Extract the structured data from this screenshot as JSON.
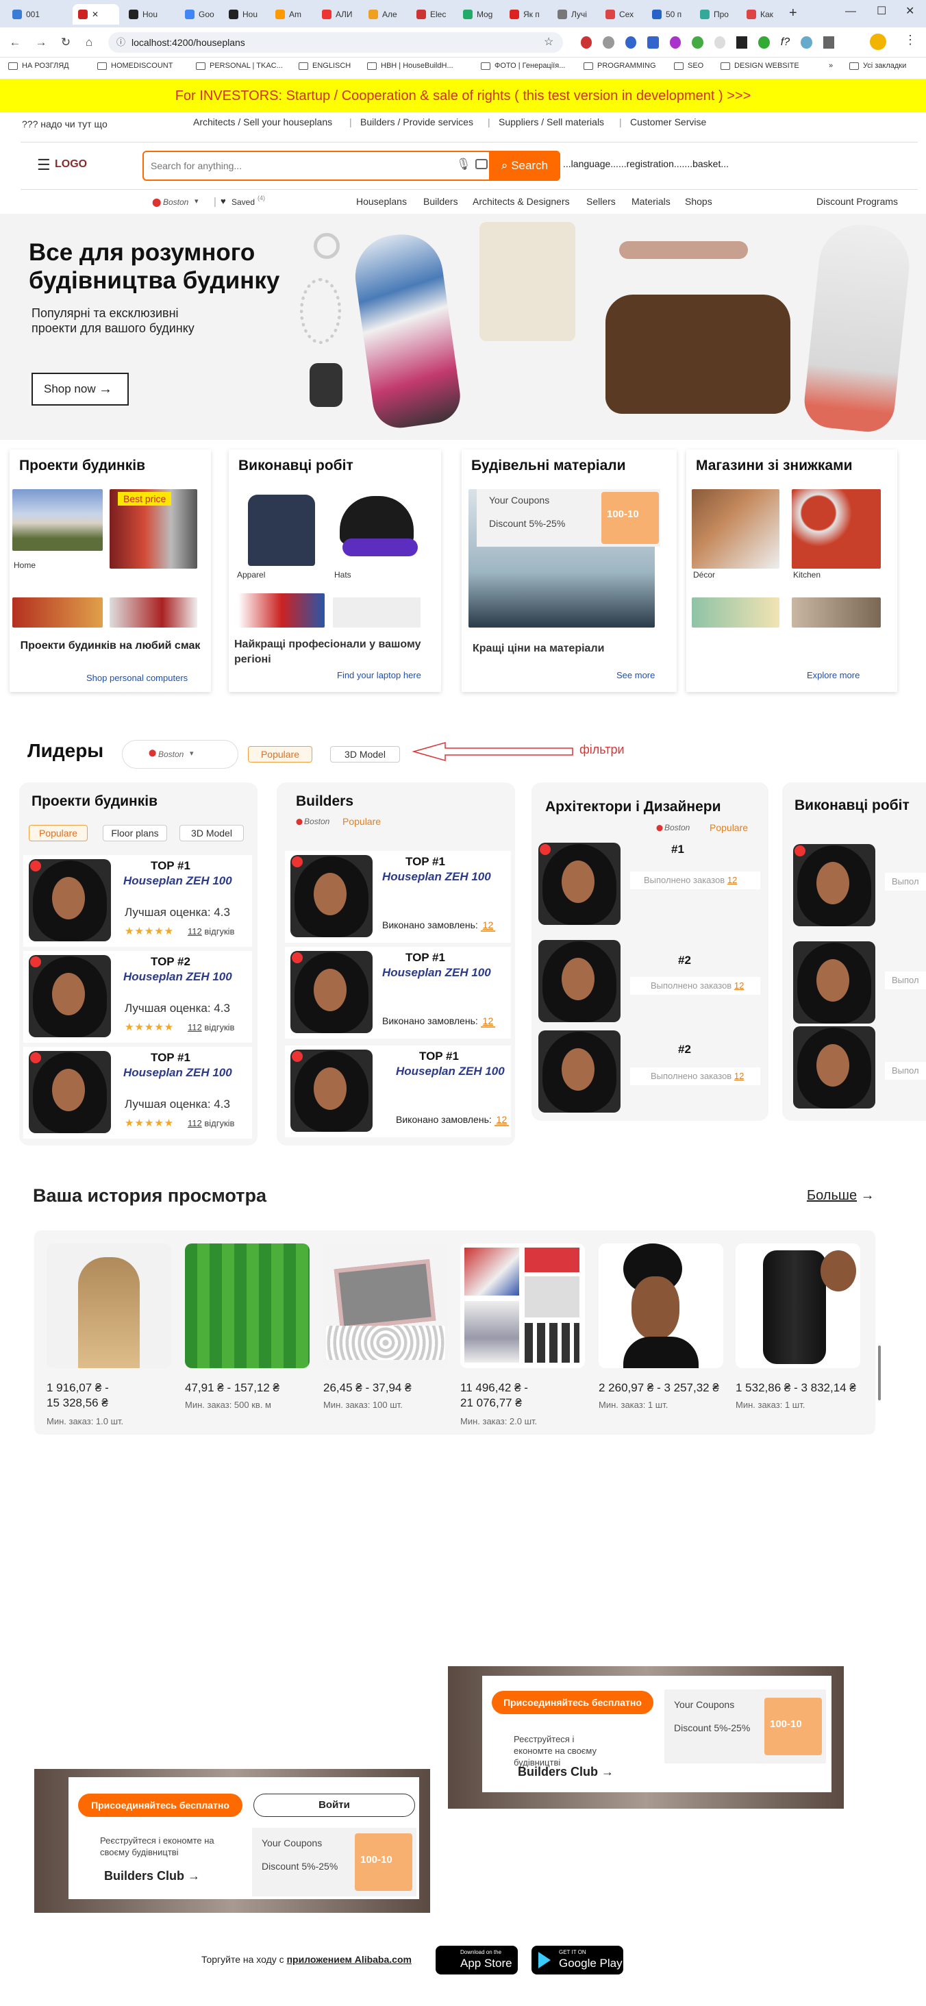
{
  "browser": {
    "tabs": [
      "001",
      "",
      "Hou",
      "Goo",
      "Hou",
      "Am",
      "AЛИ",
      "Але",
      "Elec",
      "Mog",
      "Як п",
      "Лучі",
      "Сех",
      "50 п",
      "Про",
      "Как"
    ],
    "url": "localhost:4200/houseplans",
    "bookmarks": [
      "НА РОЗГЛЯД",
      "HOMEDISCOUNT",
      "PERSONAL | TKAC...",
      "ENGLISCH",
      "НВН | HouseBuildH...",
      "ФОТО | Генераціїя...",
      "PROGRAMMING",
      "SEO",
      "DESIGN WEBSITE",
      "Усі закладки"
    ]
  },
  "banner": {
    "text": "For INVESTORS: Startup / Cooperation & sale of rights ( this test version in development ) >>>"
  },
  "toplinks": {
    "left": "??? надо чи тут щo",
    "links": [
      "Architects / Sell your houseplans",
      "Builders / Provide services",
      "Suppliers / Sell materials",
      "Customer Servise"
    ]
  },
  "header": {
    "logo": "LOGO",
    "search_placeholder": "Search for anything...",
    "search_button": "Search",
    "right_text": "...language......registration.......basket..."
  },
  "catbar": {
    "location": "Boston",
    "saved": "Saved",
    "saved_count": "(4)",
    "links": [
      "Houseplans",
      "Builders",
      "Architects & Designers",
      "Sellers",
      "Materials",
      "Shops"
    ],
    "discount": "Discount Programs"
  },
  "hero": {
    "title": "Все для розумного будівництва будинку",
    "subtitle": "Популярні та ексклюзивні проекти для вашого будинку",
    "button": "Shop now"
  },
  "cards": [
    {
      "title": "Проекти будинків",
      "captions": [
        "Home"
      ],
      "badge": "Best price",
      "footer": "Проекти будинків на любий смак",
      "link": "Shop personal computers"
    },
    {
      "title": "Виконавці робіт",
      "captions": [
        "Apparel",
        "Hats"
      ],
      "footer": "Найкращі професіонали у вашому регіоні",
      "link": "Find your laptop here"
    },
    {
      "title": "Будівельні матеріали",
      "coupon_title": "Your Coupons",
      "coupon_discount": "Discount  5%-25%",
      "coupon_value": "100-10",
      "footer": "Кращі ціни на матеріали",
      "link": "See more"
    },
    {
      "title": "Магазини зі знижками",
      "captions": [
        "Décor",
        "Kitchen"
      ],
      "link": "Explore more"
    }
  ],
  "leaders": {
    "title": "Лидеры",
    "location": "Boston",
    "filter_popular": "Populare",
    "filter_3d": "3D Model",
    "annotation": "фільтри",
    "col1": {
      "title": "Проекти будинків",
      "tabs": [
        "Populare",
        "Floor plans",
        "3D Model"
      ],
      "items": [
        {
          "top": "TOP #1",
          "name": "Houseplan ZEH 100",
          "rating": "Лучшая оценка: 4.3",
          "stars": "★★★★★",
          "reviews_count": "112",
          "reviews_label": "відгуків"
        },
        {
          "top": "TOP #2",
          "name": "Houseplan ZEH 100",
          "rating": "Лучшая оценка: 4.3",
          "stars": "★★★★★",
          "reviews_count": "112",
          "reviews_label": "відгуків"
        },
        {
          "top": "TOP #1",
          "name": "Houseplan ZEH 100",
          "rating": "Лучшая оценка: 4.3",
          "stars": "★★★★★",
          "reviews_count": "112",
          "reviews_label": "відгуків"
        }
      ]
    },
    "col2": {
      "title": "Builders",
      "location": "Boston",
      "filter": "Populare",
      "items": [
        {
          "top": "TOP #1",
          "name": "Houseplan ZEH 100",
          "done_label": "Виконано замовлень:",
          "done_count": "12"
        },
        {
          "top": "TOP #1",
          "name": "Houseplan ZEH 100",
          "done_label": "Виконано замовлень:",
          "done_count": "12"
        },
        {
          "top": "TOP #1",
          "name": "Houseplan ZEH 100",
          "done_label": "Виконано замовлень:",
          "done_count": "12"
        }
      ]
    },
    "col3": {
      "title": "Архітектори і Дизайнери",
      "location": "Boston",
      "filter": "Populare",
      "items": [
        {
          "rank": "#1",
          "done_label": "Выполнено заказов",
          "done_count": "12"
        },
        {
          "rank": "#2",
          "done_label": "Выполнено заказов",
          "done_count": "12"
        },
        {
          "rank": "#2",
          "done_label": "Выполнено заказов",
          "done_count": "12"
        }
      ]
    },
    "col4": {
      "title": "Виконавці робіт",
      "items": [
        {
          "label": "Выпол"
        },
        {
          "label": "Выпол"
        },
        {
          "label": "Выпол"
        }
      ]
    }
  },
  "history": {
    "title": "Ваша история просмотра",
    "more": "Больше",
    "items": [
      {
        "price_line1": "1 916,07 ₴ -",
        "price_line2": "15 328,56 ₴",
        "min": "Мин. заказ: 1.0 шт."
      },
      {
        "price_line1": "47,91 ₴ - 157,12 ₴",
        "price_line2": "",
        "min": "Мин. заказ: 500 кв. м"
      },
      {
        "price_line1": "26,45 ₴ - 37,94 ₴",
        "price_line2": "",
        "min": "Мин. заказ: 100 шт."
      },
      {
        "price_line1": "11 496,42 ₴ -",
        "price_line2": "21 076,77 ₴",
        "min": "Мин. заказ: 2.0 шт."
      },
      {
        "price_line1": "2 260,97 ₴ - 3 257,32 ₴",
        "price_line2": "",
        "min": "Мин. заказ: 1 шт."
      },
      {
        "price_line1": "1 532,86 ₴ - 3 832,14 ₴",
        "price_line2": "",
        "min": "Мин. заказ: 1 шт."
      }
    ]
  },
  "promo1": {
    "join": "Присоединяйтесь бесплатно",
    "text": "Реєструйтеся і економте на своєму будівництві",
    "club": "Builders Club",
    "coupon_title": "Your Coupons",
    "coupon_discount": "Discount  5%-25%",
    "coupon_value": "100-10"
  },
  "promo2": {
    "join": "Присоединяйтесь бесплатно",
    "login": "Войти",
    "text": "Реєструйтеся і економте на своєму будівництві",
    "club": "Builders Club",
    "coupon_title": "Your Coupons",
    "coupon_discount": "Discount  5%-25%",
    "coupon_value": "100-10"
  },
  "footer": {
    "text": "Торгуйте на ходу с",
    "link": "приложением Alibaba.com",
    "appstore_small": "Download on the",
    "appstore": "App Store",
    "googleplay_small": "GET IT ON",
    "googleplay": "Google Play"
  }
}
